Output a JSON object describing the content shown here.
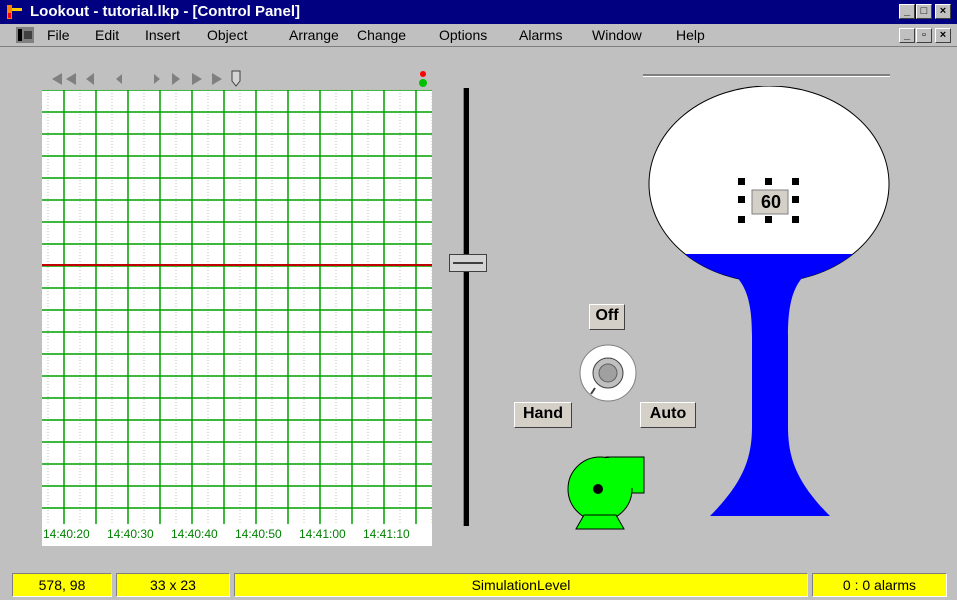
{
  "window": {
    "title": "Lookout - tutorial.lkp - [Control Panel]",
    "controls": {
      "minimize": "_",
      "maximize": "□",
      "close": "×"
    }
  },
  "menubar": {
    "items": [
      "File",
      "Edit",
      "Insert",
      "Object",
      "Arrange",
      "Change",
      "Options",
      "Alarms",
      "Window",
      "Help"
    ],
    "mdi_controls": {
      "minimize": "_",
      "restore": "▫",
      "close": "×"
    }
  },
  "trend": {
    "times": [
      "14:40:20",
      "14:40:30",
      "14:40:40",
      "14:40:50",
      "14:41:00",
      "14:41:10"
    ],
    "grid_color": "#00a000",
    "trace_color": "#c00000"
  },
  "tank": {
    "value": "60",
    "water_color": "#0000ff"
  },
  "hoa_switch": {
    "off_label": "Off",
    "hand_label": "Hand",
    "auto_label": "Auto"
  },
  "pump": {
    "color": "#00ff00"
  },
  "statusbar": {
    "coords": "578, 98",
    "size": "33 x 23",
    "object_name": "SimulationLevel",
    "alarms": "0 : 0 alarms",
    "bg_color": "#ffff00"
  }
}
